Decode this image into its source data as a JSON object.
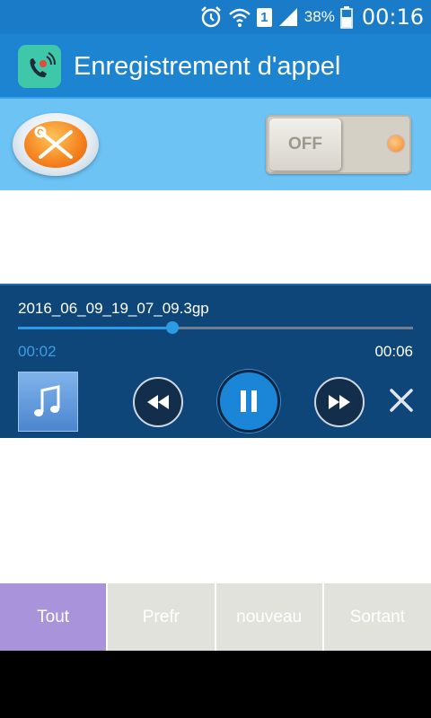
{
  "status_bar": {
    "battery_percent": "38%",
    "time": "00:16",
    "sim": "1",
    "icons": [
      "alarm-icon",
      "wifi-icon",
      "sim-icon",
      "signal-icon",
      "battery-icon"
    ]
  },
  "app_bar": {
    "title": "Enregistrement d'appel",
    "icon": "call-recorder-icon"
  },
  "toolbar": {
    "settings_icon": "tools-icon",
    "toggle_label": "OFF"
  },
  "player": {
    "filename": "2016_06_09_19_07_09.3gp",
    "current_time": "00:02",
    "total_time": "00:06",
    "progress": 0.39,
    "icons": [
      "music-note-icon",
      "rewind-icon",
      "pause-icon",
      "fast-forward-icon",
      "close-icon"
    ]
  },
  "tabs": [
    {
      "label": "Tout",
      "active": true
    },
    {
      "label": "Prefr",
      "active": false
    },
    {
      "label": "nouveau",
      "active": false
    },
    {
      "label": "Sortant",
      "active": false
    }
  ],
  "colors": {
    "app_bar": "#1d84d2",
    "toolbar": "#6cc3f4",
    "player": "#0e4679",
    "accent": "#2c9be6",
    "active_tab": "#a994dc",
    "inactive_tab": "#e2e2dc"
  }
}
